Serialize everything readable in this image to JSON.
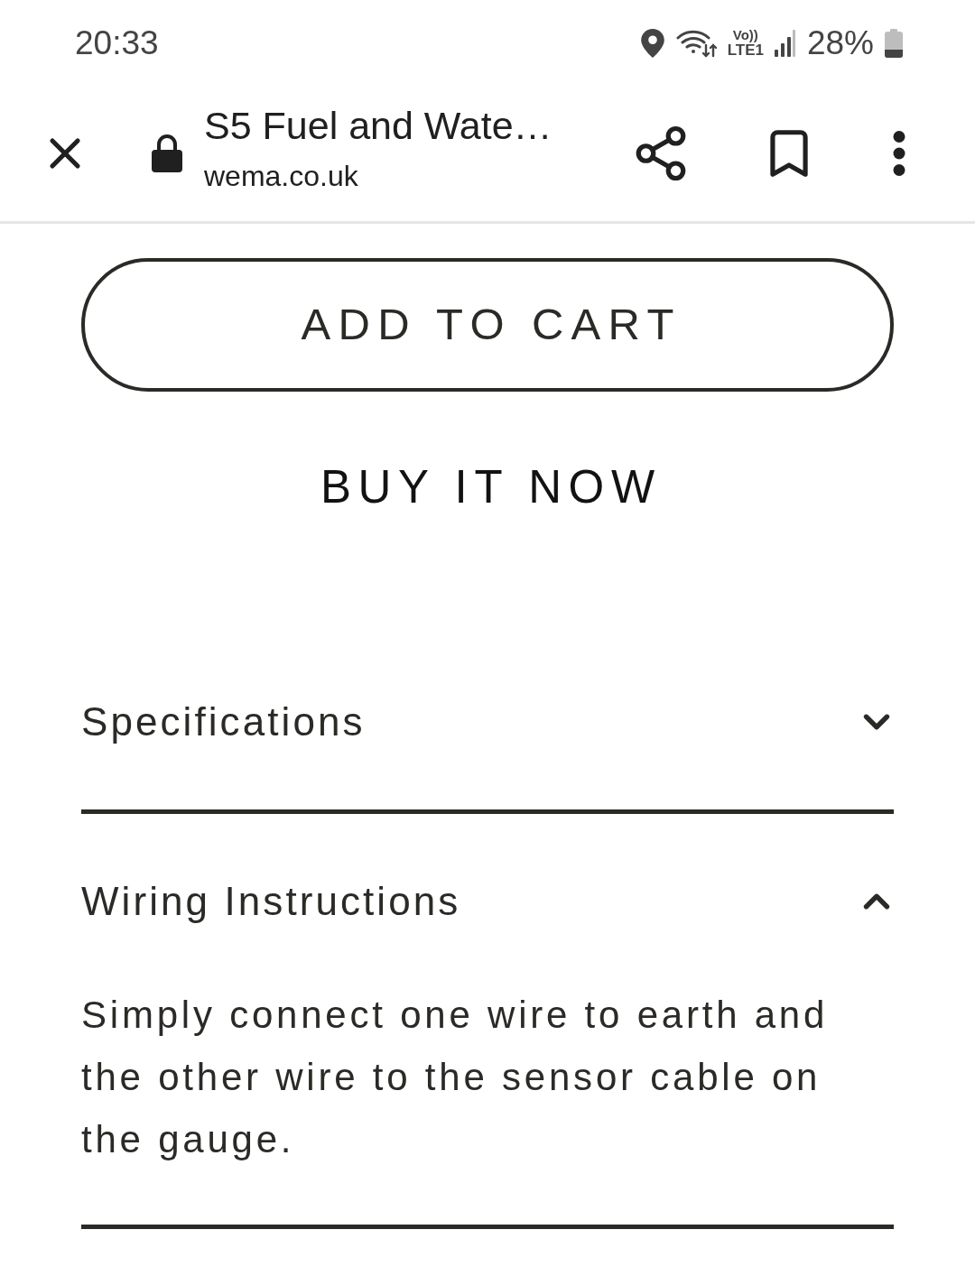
{
  "status_bar": {
    "time": "20:33",
    "network_top": "Vo))",
    "network_bottom": "LTE1",
    "battery": "28%"
  },
  "browser_bar": {
    "title": "S5 Fuel and Wate…",
    "domain": "wema.co.uk"
  },
  "actions": [
    {
      "kind": "outline",
      "label": "ADD TO CART"
    },
    {
      "kind": "text",
      "label": "BUY IT NOW"
    }
  ],
  "accordion": [
    {
      "title": "Specifications",
      "expanded": false
    },
    {
      "title": "Wiring Instructions",
      "expanded": true,
      "body": "Simply connect one wire to earth and the other wire to the sensor cable on the gauge."
    }
  ]
}
